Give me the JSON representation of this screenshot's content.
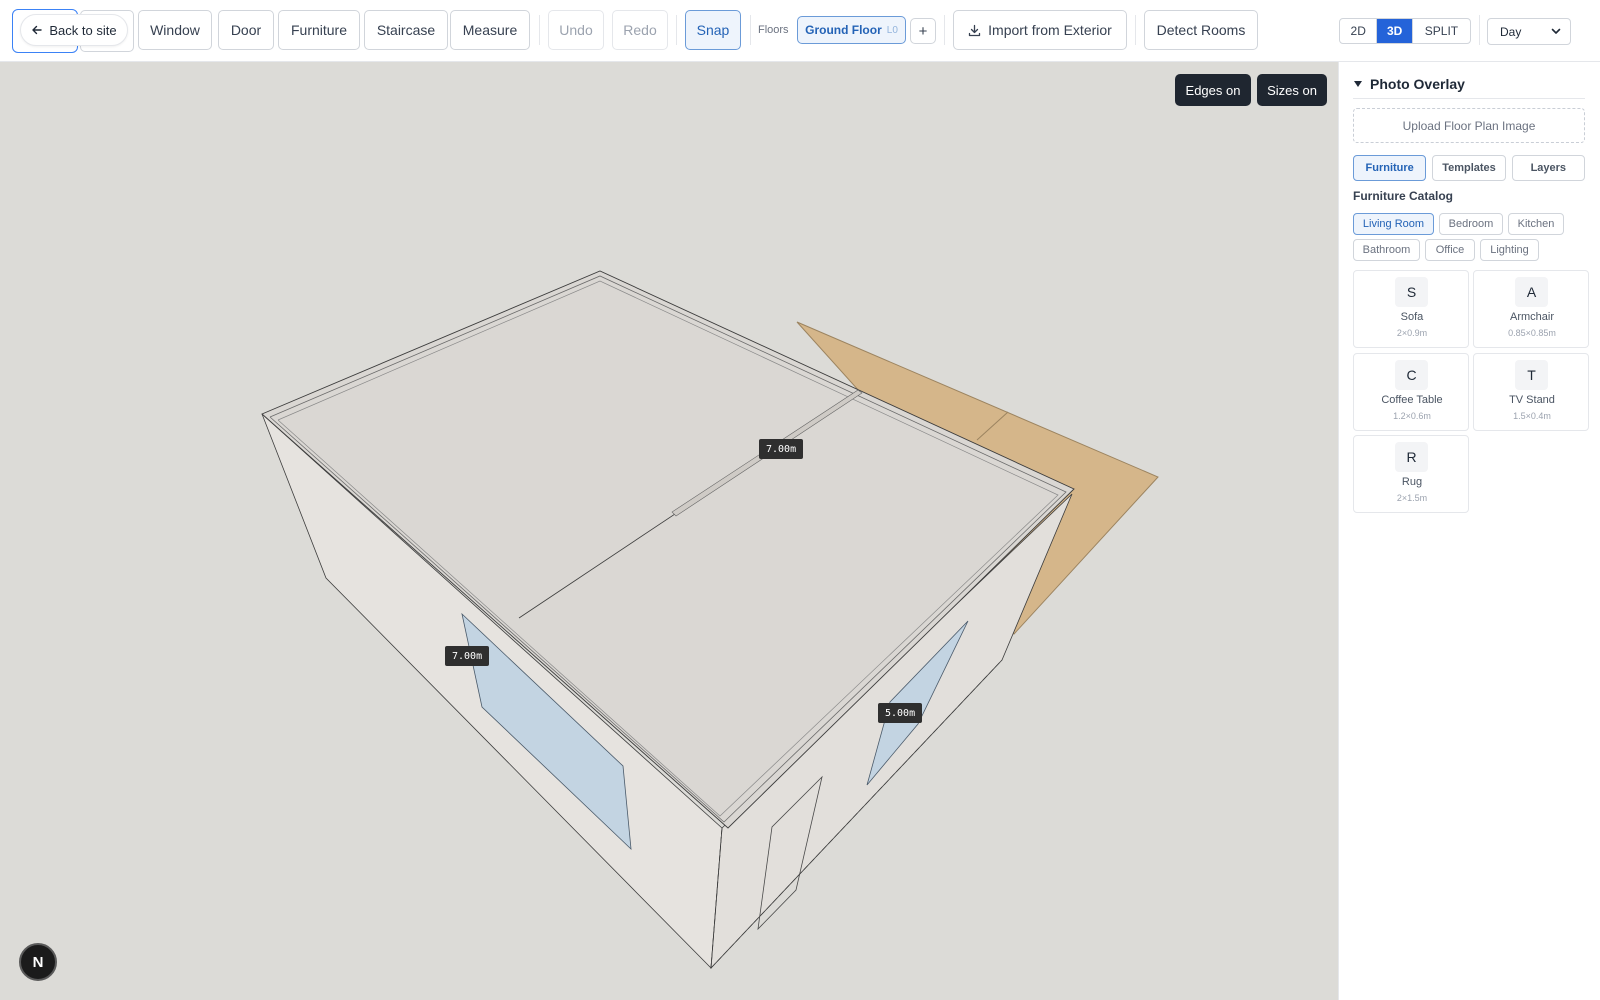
{
  "toolbar": {
    "back_label": "Back to site",
    "tools": [
      "Window",
      "Door",
      "Furniture",
      "Staircase",
      "Measure"
    ],
    "undo_label": "Undo",
    "redo_label": "Redo",
    "snap_label": "Snap",
    "floors_label": "Floors",
    "floor_chip": {
      "name": "Ground Floor",
      "level": "L0"
    },
    "add_floor_label": "+",
    "import_label": "Import from Exterior",
    "detect_label": "Detect Rooms",
    "view_modes": [
      "2D",
      "3D",
      "SPLIT"
    ],
    "active_view": "3D",
    "time_of_day": "Day"
  },
  "viewport": {
    "edges_label": "Edges on",
    "sizes_label": "Sizes on",
    "dimension_labels": [
      "7.00m",
      "7.00m",
      "5.00m"
    ],
    "badge_label": "N"
  },
  "panel": {
    "overlay_title": "Photo Overlay",
    "upload_label": "Upload Floor Plan Image",
    "tabs": [
      "Furniture",
      "Templates",
      "Layers"
    ],
    "active_tab": "Furniture",
    "catalog_title": "Furniture Catalog",
    "categories": [
      "Living Room",
      "Bedroom",
      "Kitchen",
      "Bathroom",
      "Office",
      "Lighting"
    ],
    "active_category": "Living Room",
    "items": [
      {
        "letter": "S",
        "name": "Sofa",
        "size": "2×0.9m"
      },
      {
        "letter": "A",
        "name": "Armchair",
        "size": "0.85×0.85m"
      },
      {
        "letter": "C",
        "name": "Coffee Table",
        "size": "1.2×0.6m"
      },
      {
        "letter": "T",
        "name": "TV Stand",
        "size": "1.5×0.4m"
      },
      {
        "letter": "R",
        "name": "Rug",
        "size": "2×1.5m"
      }
    ]
  },
  "colors": {
    "accent": "#2463d9",
    "viewport_bg": "#dcdbd7",
    "wall": "#e6e3df",
    "ground": "#d5b68a",
    "window_glass": "#c3d4e2"
  }
}
